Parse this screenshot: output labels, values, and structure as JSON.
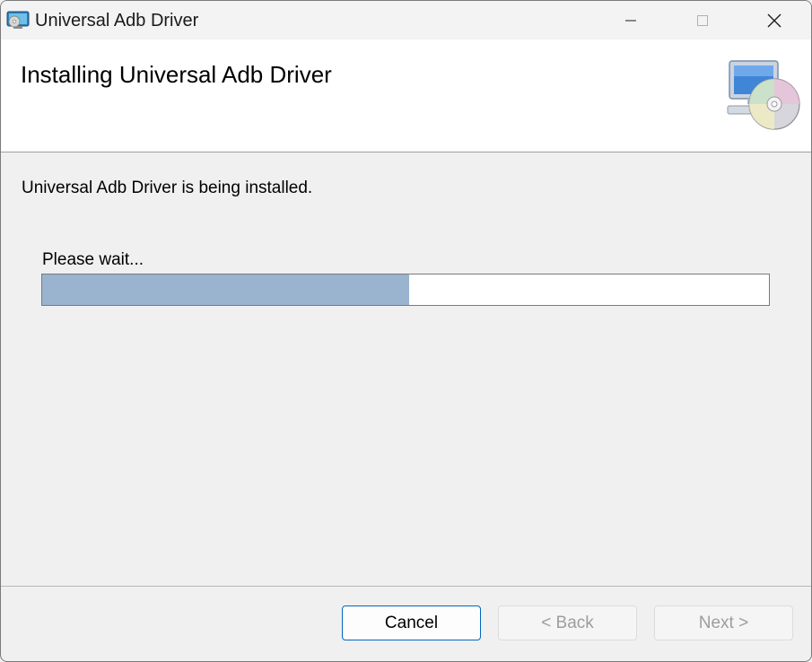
{
  "window": {
    "title": "Universal Adb Driver",
    "icon": "installer-app-icon",
    "controls": {
      "minimize_icon": "minimize-icon",
      "maximize_icon": "maximize-icon",
      "close_icon": "close-icon"
    }
  },
  "header": {
    "title": "Installing Universal Adb Driver",
    "graphic": "computer-cd-icon"
  },
  "body": {
    "status": "Universal Adb Driver is being installed.",
    "wait_label": "Please wait...",
    "progress_fraction": 0.505,
    "progress_color": "#9ab3cf"
  },
  "buttons": {
    "cancel": "Cancel",
    "back": "< Back",
    "next": "Next >"
  },
  "colors": {
    "accent": "#0067c0",
    "disabled_text": "#9d9d9d"
  }
}
